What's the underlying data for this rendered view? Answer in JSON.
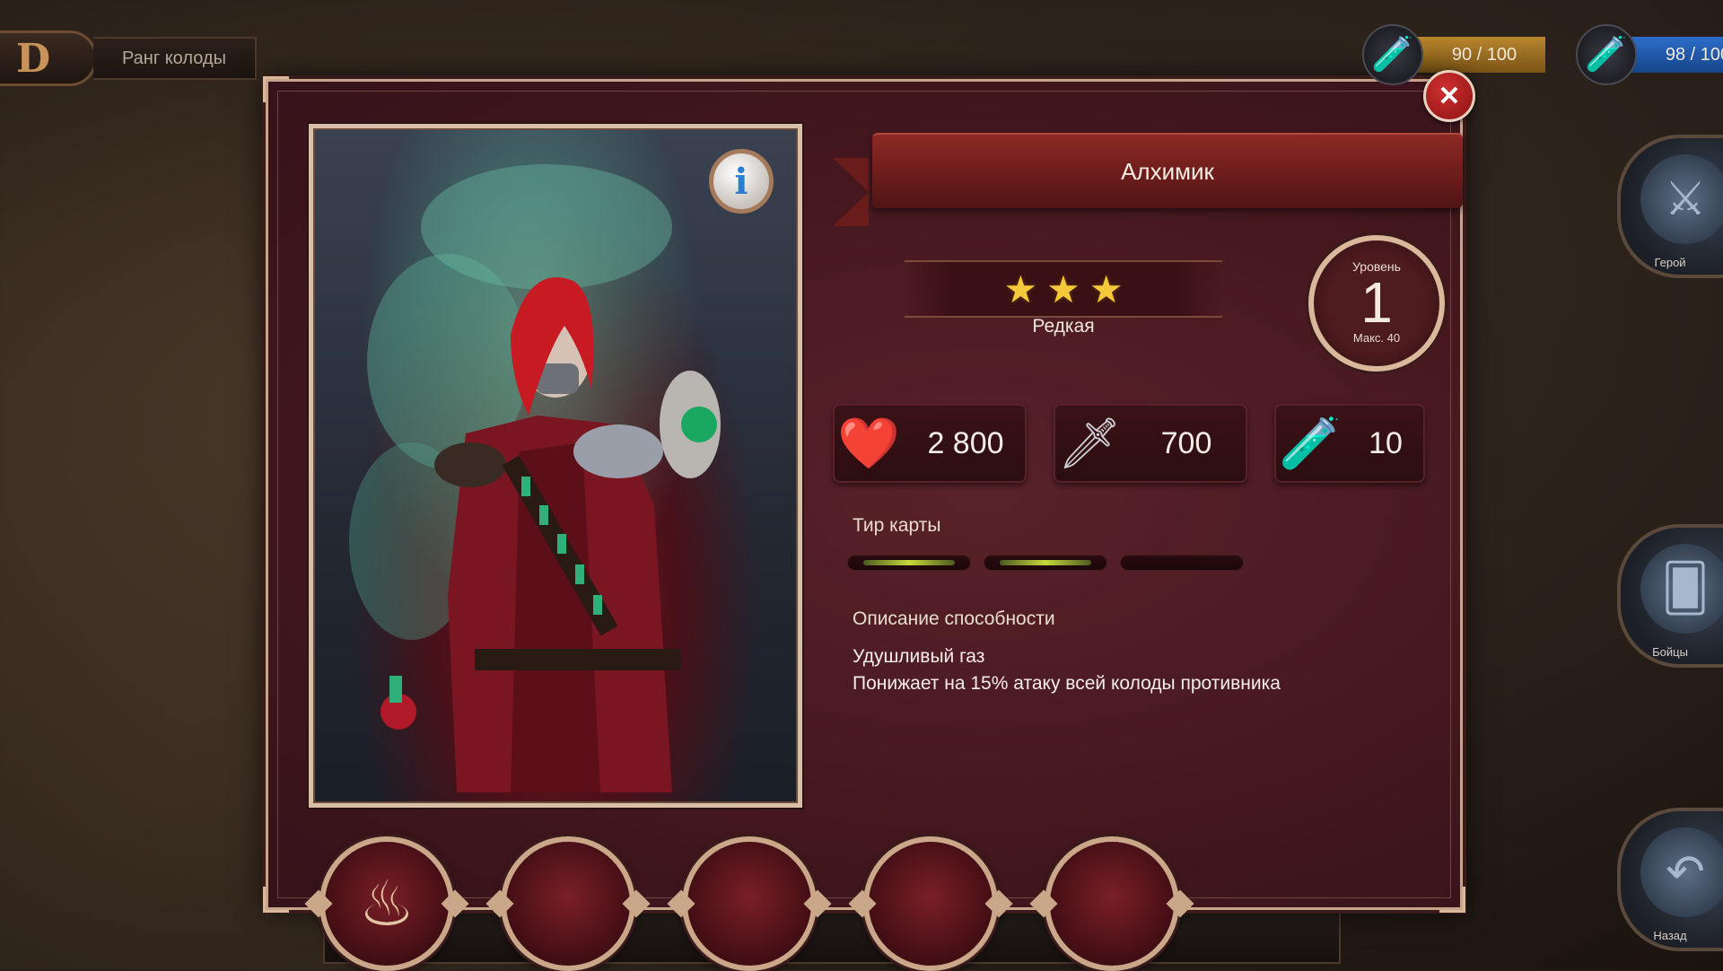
{
  "hud": {
    "rank_letter": "D",
    "rank_label": "Ранг колоды",
    "gold_value": "90 / 100",
    "mana_value": "98 / 100"
  },
  "side_nav": [
    {
      "label": "Герой",
      "icon": "knight-icon"
    },
    {
      "label": "Бойцы",
      "icon": "cards-icon"
    },
    {
      "label": "Назад",
      "icon": "back-arrow-icon"
    }
  ],
  "card": {
    "name": "Алхимик",
    "stars": [
      "★",
      "★",
      "★"
    ],
    "rarity": "Редкая",
    "info_glyph": "i",
    "level": {
      "title": "Уровень",
      "value": "1",
      "max": "Макс. 40"
    },
    "stats": {
      "health": "2 800",
      "attack": "700",
      "mana": "10"
    },
    "tier": {
      "label": "Тир карты",
      "filled": 2,
      "total": 3
    },
    "ability": {
      "heading": "Описание способности",
      "name": "Удушливый газ",
      "description": "Понижает на 15% атаку всей колоды противника"
    }
  },
  "close_glyph": "✕",
  "sockets": [
    {
      "filled": true,
      "icon": "flame-rune-icon",
      "glyph": "♨"
    },
    {
      "filled": false
    },
    {
      "filled": false
    },
    {
      "filled": false
    },
    {
      "filled": false
    }
  ],
  "colors": {
    "panel": "#43171d",
    "frame": "#c7a58a",
    "ribbon": "#8c2a25",
    "star": "#f5c93a",
    "close": "#d13030"
  }
}
